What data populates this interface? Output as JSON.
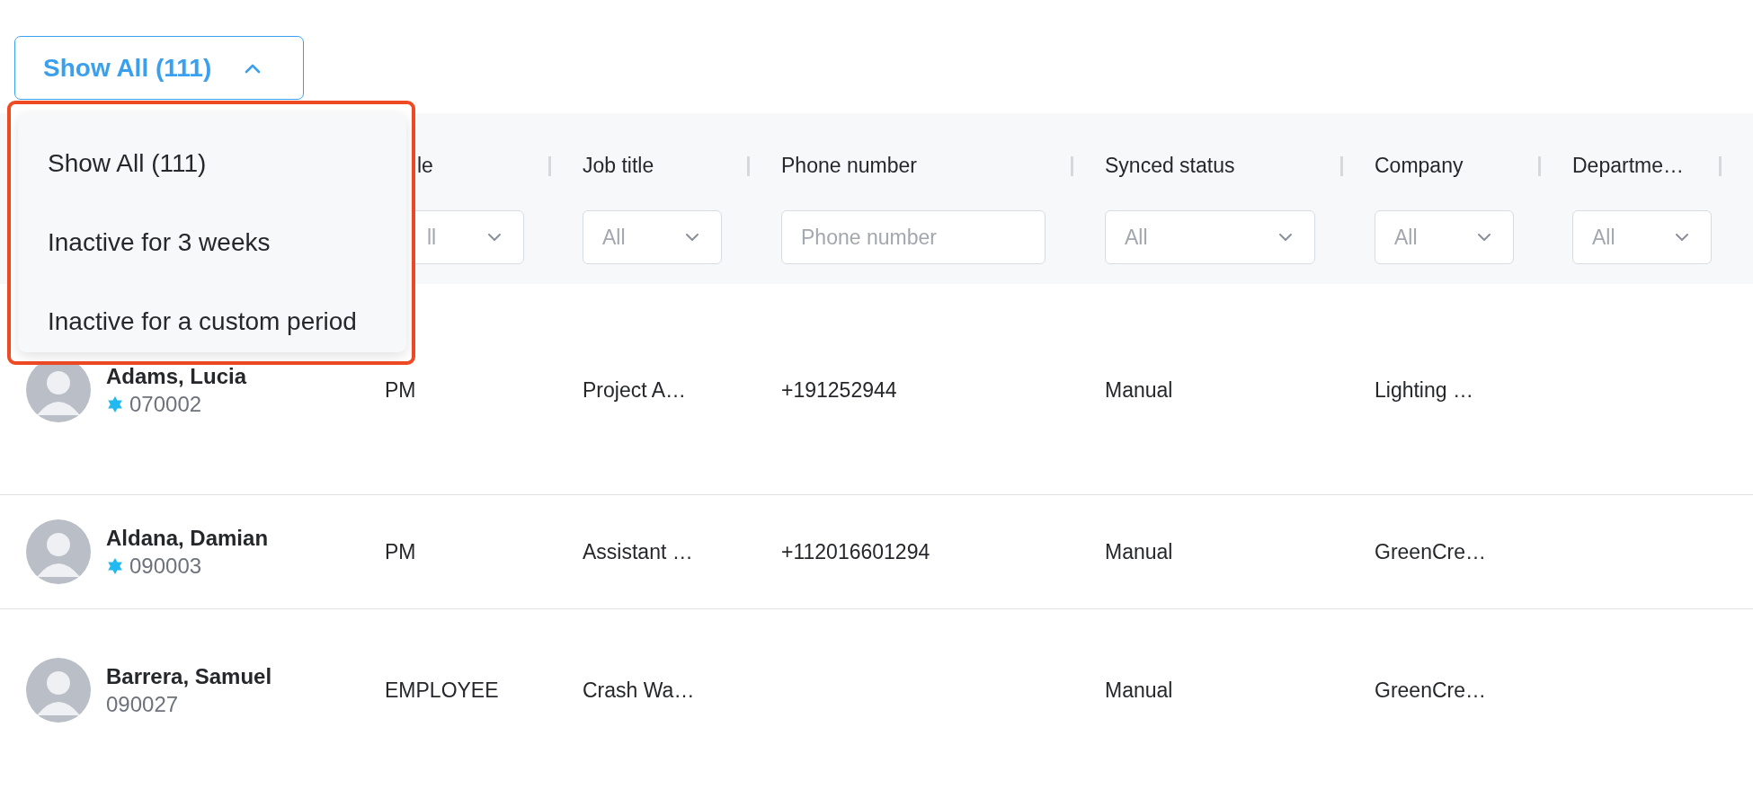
{
  "filter_button": {
    "label": "Show All (111)",
    "expanded": true
  },
  "filter_menu": {
    "items": [
      {
        "label": "Show All (111)"
      },
      {
        "label": "Inactive for 3 weeks"
      },
      {
        "label": "Inactive for a custom period"
      }
    ]
  },
  "table": {
    "columns": [
      {
        "label": "le",
        "filter": {
          "kind": "select",
          "value": "ll"
        }
      },
      {
        "label": "Job title",
        "filter": {
          "kind": "select",
          "value": "All"
        }
      },
      {
        "label": "Phone number",
        "filter": {
          "kind": "input",
          "placeholder": "Phone number"
        }
      },
      {
        "label": "Synced status",
        "filter": {
          "kind": "select",
          "value": "All"
        }
      },
      {
        "label": "Company",
        "filter": {
          "kind": "select",
          "value": "All"
        }
      },
      {
        "label": "Departme…",
        "filter": {
          "kind": "select",
          "value": "All"
        }
      }
    ],
    "rows": [
      {
        "name": "Adams, Lucia",
        "employee_id": "070002",
        "verified": true,
        "cells": [
          "PM",
          "Project A…",
          "+191252944",
          "Manual",
          "Lighting …"
        ]
      },
      {
        "name": "Aldana, Damian",
        "employee_id": "090003",
        "verified": true,
        "cells": [
          "PM",
          "Assistant …",
          "+112016601294",
          "Manual",
          "GreenCre…"
        ]
      },
      {
        "name": "Barrera, Samuel",
        "employee_id": "090027",
        "verified": false,
        "cells": [
          "EMPLOYEE",
          "Crash Wa…",
          "",
          "Manual",
          "GreenCre…"
        ]
      }
    ]
  }
}
